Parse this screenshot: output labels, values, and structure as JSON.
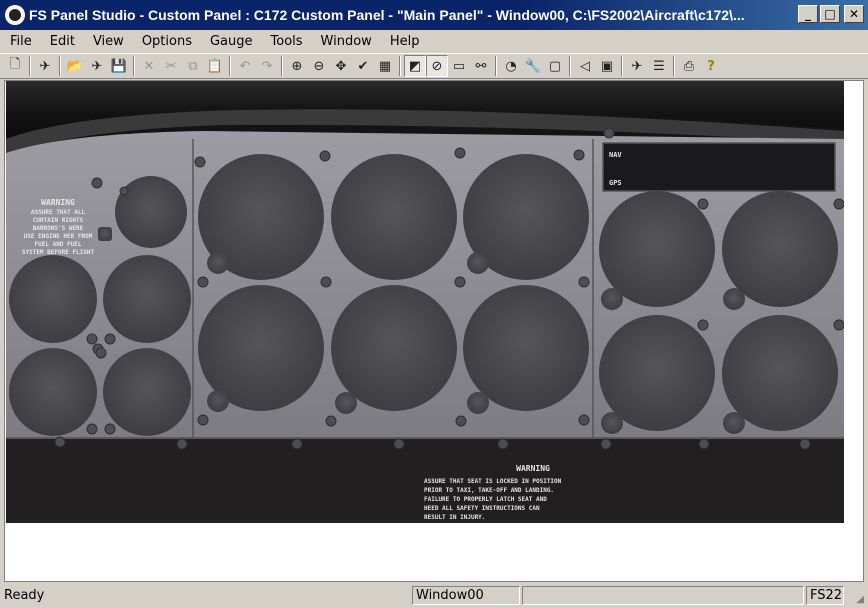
{
  "window": {
    "title": "FS Panel Studio - Custom Panel : C172 Custom Panel - \"Main Panel\" - Window00, C:\\FS2002\\Aircraft\\c172\\..."
  },
  "menu": [
    "File",
    "Edit",
    "View",
    "Options",
    "Gauge",
    "Tools",
    "Window",
    "Help"
  ],
  "panel": {
    "nav_label": "NAV",
    "gps_label": "GPS",
    "warning_left_title": "WARNING",
    "warning_left_lines": [
      "ASSURE THAT ALL",
      "CURTAIN RIGHTS",
      "BARRONS'S WERE",
      "USE ENGINE HER FROM",
      "FUEL AND FUEL",
      "SYSTEM BEFORE FLIGHT"
    ],
    "warning_bottom_title": "WARNING",
    "warning_bottom_lines": [
      "ASSURE THAT SEAT IS LOCKED IN POSITION",
      "PRIOR TO TAXI, TAKE-OFF AND LANDING.",
      "FAILURE TO PROPERLY LATCH SEAT AND",
      "HEED ALL SAFETY INSTRUCTIONS CAN",
      "RESULT IN INJURY."
    ]
  },
  "status": {
    "ready": "Ready",
    "window": "Window00",
    "extra": "",
    "version": "FS22"
  },
  "colors": {
    "title_bar": "#0a246a",
    "chrome": "#d4d0c8",
    "panel_metal": "#8a8a90",
    "gauge_hole": "#4a4a4e"
  }
}
